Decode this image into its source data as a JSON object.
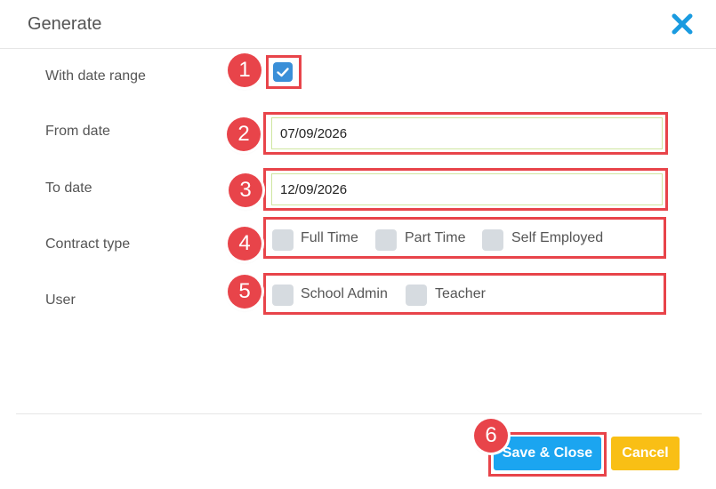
{
  "dialog": {
    "title": "Generate"
  },
  "fields": {
    "date_range": {
      "label": "With date range",
      "checked": true
    },
    "from_date": {
      "label": "From date",
      "value": "07/09/2026"
    },
    "to_date": {
      "label": "To date",
      "value": "12/09/2026"
    },
    "contract_type": {
      "label": "Contract type",
      "options": [
        "Full Time",
        "Part Time",
        "Self Employed"
      ]
    },
    "user": {
      "label": "User",
      "options": [
        "School Admin",
        "Teacher"
      ]
    }
  },
  "buttons": {
    "save_close": "Save & Close",
    "cancel": "Cancel"
  },
  "markers": [
    "1",
    "2",
    "3",
    "4",
    "5",
    "6"
  ],
  "icons": {
    "close": "close-icon",
    "check": "checkmark-icon"
  },
  "colors": {
    "accent_blue": "#1ba5f0",
    "cancel_yellow": "#f9bf15",
    "highlight_red": "#e8444a",
    "close_blue": "#1a9be0",
    "checkbox_checked": "#3a8fd8",
    "checkbox_unchecked": "#d6dbe0"
  }
}
